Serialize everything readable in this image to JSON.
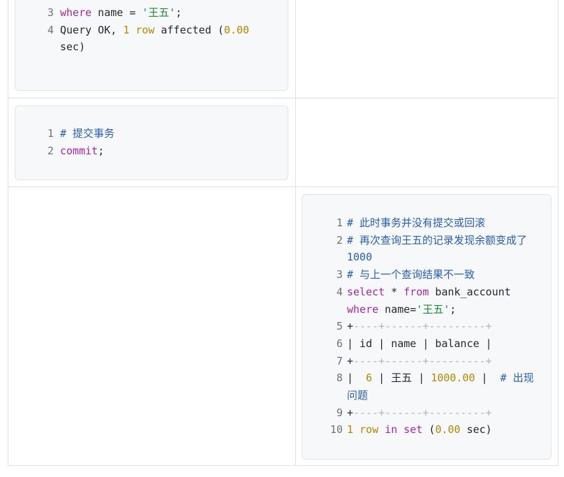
{
  "cell_1": {
    "lines": [
      {
        "num": "3",
        "parts": [
          [
            "where",
            "k"
          ],
          [
            " name = ",
            "p"
          ],
          [
            "'王五'",
            "s"
          ],
          [
            ";",
            "p"
          ]
        ]
      },
      {
        "num": "4",
        "parts": [
          [
            "Query OK, ",
            "p"
          ],
          [
            "1",
            "n"
          ],
          [
            " ",
            "p"
          ],
          [
            "row",
            "n"
          ],
          [
            " affected (",
            "p"
          ],
          [
            "0.00",
            "n"
          ]
        ]
      },
      {
        "num": "",
        "parts": [
          [
            "sec)",
            "p"
          ]
        ]
      }
    ]
  },
  "cell_2": {
    "lines": [
      {
        "num": "1",
        "parts": [
          [
            "# 提交事务",
            "c"
          ]
        ]
      },
      {
        "num": "2",
        "parts": [
          [
            "commit",
            "k"
          ],
          [
            ";",
            "p"
          ]
        ]
      }
    ]
  },
  "cell_3": {
    "lines": [
      {
        "num": "1",
        "parts": [
          [
            "# 此时事务并没有提交或回滚",
            "c"
          ]
        ]
      },
      {
        "num": "2",
        "parts": [
          [
            "# 再次查询王五的记录发现余额变成了",
            "c"
          ]
        ]
      },
      {
        "num": "",
        "parts": [
          [
            "1000",
            "c"
          ]
        ]
      },
      {
        "num": "3",
        "parts": [
          [
            "# 与上一个查询结果不一致",
            "c"
          ]
        ]
      },
      {
        "num": "4",
        "parts": [
          [
            "select",
            "k"
          ],
          [
            " * ",
            "p"
          ],
          [
            "from",
            "k"
          ],
          [
            " bank_account",
            "p"
          ]
        ]
      },
      {
        "num": "",
        "parts": [
          [
            "where",
            "k"
          ],
          [
            " name=",
            "p"
          ],
          [
            "'王五'",
            "s"
          ],
          [
            ";",
            "p"
          ]
        ]
      },
      {
        "num": "5",
        "parts": [
          [
            "+",
            "p"
          ],
          [
            "----+------+---------+",
            "dash"
          ]
        ]
      },
      {
        "num": "6",
        "parts": [
          [
            "| id | name | balance |",
            "p"
          ]
        ]
      },
      {
        "num": "7",
        "parts": [
          [
            "+",
            "p"
          ],
          [
            "----+------+---------+",
            "dash"
          ]
        ]
      },
      {
        "num": "8",
        "parts": [
          [
            "|  ",
            "p"
          ],
          [
            "6",
            "n"
          ],
          [
            " | 王五 | ",
            "p"
          ],
          [
            "1000.00",
            "n"
          ],
          [
            " |  ",
            "p"
          ],
          [
            "# 出现",
            "c"
          ]
        ]
      },
      {
        "num": "",
        "parts": [
          [
            "问题",
            "c"
          ]
        ]
      },
      {
        "num": "9",
        "parts": [
          [
            "+",
            "p"
          ],
          [
            "----+------+---------+",
            "dash"
          ]
        ]
      },
      {
        "num": "10",
        "parts": [
          [
            "1",
            "n"
          ],
          [
            " ",
            "p"
          ],
          [
            "row",
            "n"
          ],
          [
            " ",
            "p"
          ],
          [
            "in",
            "k"
          ],
          [
            " ",
            "p"
          ],
          [
            "set",
            "k"
          ],
          [
            " (",
            "p"
          ],
          [
            "0.00",
            "n"
          ],
          [
            " sec)",
            "p"
          ]
        ]
      }
    ]
  }
}
